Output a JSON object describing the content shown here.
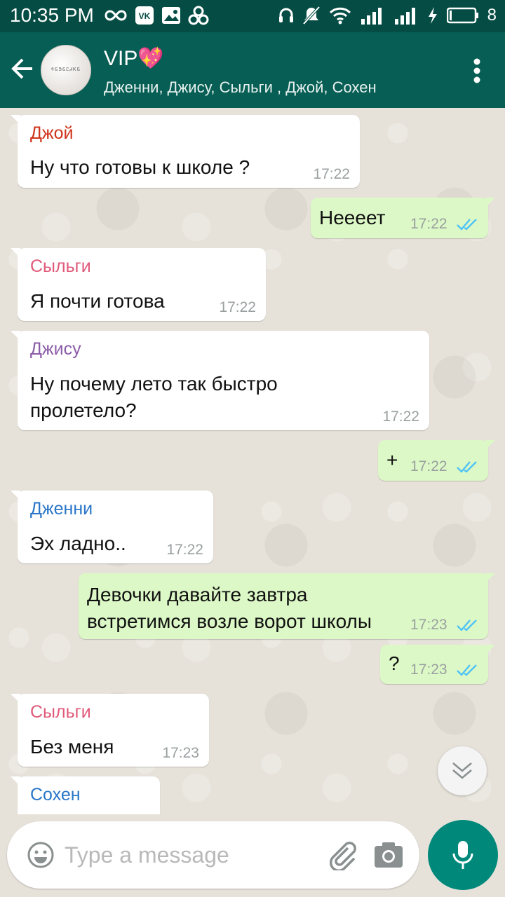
{
  "status_bar": {
    "time": "10:35 PM",
    "battery": "8"
  },
  "header": {
    "back_icon": "arrow-left-icon",
    "title": "VIP💖",
    "subtitle": "Дженни, Джису, Сыльги , Джой, Сохен",
    "avatar_text": "ᏎᏋᏕᏋᏝᏗᏦᏋ"
  },
  "messages": [
    {
      "dir": "in",
      "sender": "Джой",
      "sender_color": "#d0331c",
      "text": "Ну что готовы к школе ?",
      "time": "17:22"
    },
    {
      "dir": "out",
      "text": "Неееет",
      "time": "17:22"
    },
    {
      "dir": "in",
      "sender": "Сыльги",
      "sender_color": "#e05a7a",
      "text": "Я почти готова",
      "time": "17:22"
    },
    {
      "dir": "in",
      "sender": "Джису",
      "sender_color": "#8b5ca8",
      "text": "Ну почему лето так быстро\nпролетело?",
      "time": "17:22"
    },
    {
      "dir": "out",
      "text": "+",
      "time": "17:22"
    },
    {
      "dir": "in",
      "sender": "Дженни",
      "sender_color": "#2a76c8",
      "text": "Эх ладно..",
      "time": "17:22"
    },
    {
      "dir": "out",
      "text": "Девочки давайте завтра\nвстретимся возле ворот школы",
      "time": "17:23"
    },
    {
      "dir": "out",
      "text": "?",
      "time": "17:23"
    },
    {
      "dir": "in",
      "sender": "Сыльги",
      "sender_color": "#e05a7a",
      "text": "Без меня",
      "time": "17:23"
    },
    {
      "dir": "in",
      "sender": "Сохен",
      "sender_color": "#2a76c8"
    }
  ],
  "input": {
    "placeholder": "Type a message"
  },
  "colors": {
    "header": "#075e54",
    "statusbar": "#054d44",
    "outgoing": "#dcf8c6",
    "incoming": "#ffffff",
    "accent": "#00897b",
    "read_ticks": "#4fc3f7"
  },
  "icons": [
    "infinity-icon",
    "vk-icon",
    "image-icon",
    "wind-icon",
    "headphones-icon",
    "mute-icon",
    "wifi-icon",
    "signal-icon",
    "battery-icon",
    "more-vert-icon",
    "emoji-icon",
    "attach-icon",
    "camera-icon",
    "mic-icon",
    "chevron-down-icon",
    "double-check-icon"
  ]
}
